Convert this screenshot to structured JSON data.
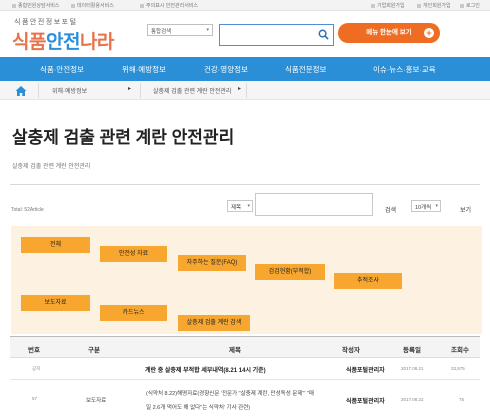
{
  "topbar": {
    "left_links": [
      "종합민원상담서비스",
      "데이터활용서비스",
      "주의표시 안전관리서비스"
    ],
    "right_links": [
      "기업회원가입",
      "개인회원가입",
      "로그인"
    ]
  },
  "logo": {
    "sub": "식품안전정보포털",
    "main_a": "식품",
    "main_b": "안전",
    "main_c": "나라"
  },
  "search": {
    "select_value": "통합검색",
    "input_value": ""
  },
  "promo": {
    "label": "메뉴 한눈에 보기",
    "plus": "+"
  },
  "gnb": {
    "items": [
      "식품·안전정보",
      "위해·예방정보",
      "건강·영양정보",
      "식품전문정보",
      "이슈·뉴스·홍보·교육"
    ]
  },
  "breadcrumb": {
    "level1": "위해·예방정보",
    "level2": "살충제 검출 관련 계란 안전관리"
  },
  "page": {
    "title": "살충제 검출 관련 계란 안전관리",
    "description": "살충제 검출 관련 계란 안전관리"
  },
  "filter": {
    "total": "Total: 52Article",
    "field_select": "제목",
    "query": "",
    "search_button": "검색",
    "page_size": "10개씩",
    "view_button": "보기"
  },
  "categories": [
    "전체",
    "안전성 자료",
    "자주하는 질문(FAQ)",
    "검검현황(부적합)",
    "추적조사",
    "보도자료",
    "카드뉴스",
    "살충제 검출 계란 검색"
  ],
  "table": {
    "headers": [
      "번호",
      "구분",
      "제목",
      "작성자",
      "등록일",
      "조회수"
    ],
    "rows": [
      {
        "no": "공지",
        "category": "",
        "title": "계란 중 살충제 부적합 세부내역(8.21 14시 기준)",
        "author": "식품포털관리자",
        "date": "2017.08.21",
        "views": "33,575"
      },
      {
        "no": "57",
        "category": "보도자료",
        "title": "(식약처 8.22)해명자료(경향신문 '전문가 \"살충제 계란, 만성독성 문제\"' \"매",
        "title2": "일 2.6개 먹어도 해 없다\"는 식약처' 기사 관련)",
        "author": "식품포털관리자",
        "date": "2017.08.22",
        "views": "75"
      }
    ]
  }
}
